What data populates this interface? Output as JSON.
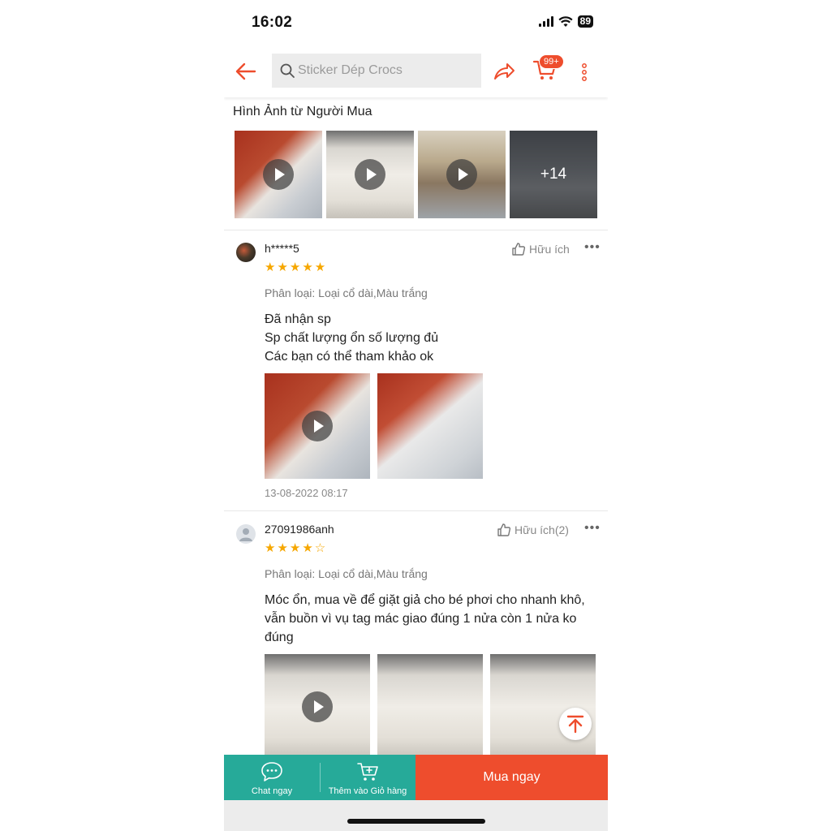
{
  "status_bar": {
    "time": "16:02",
    "battery": "89"
  },
  "header": {
    "search_placeholder": "Sticker Dép Crocs",
    "cart_badge": "99+"
  },
  "buyer_media": {
    "title": "Hình Ảnh từ Người Mua",
    "more_count": "+14"
  },
  "reviews": [
    {
      "username": "h*****5",
      "rating": 5,
      "stars": "★★★★★",
      "helpful": "Hữu ích",
      "variant": "Phân loại: Loại cổ dài,Màu trắng",
      "lines": [
        "Đã nhận sp",
        "Sp chất lượng ổn số lượng đủ",
        "Các bạn có thể tham khảo ok"
      ],
      "date": "13-08-2022 08:17"
    },
    {
      "username": "27091986anh",
      "rating": 4,
      "stars": "★★★★☆",
      "helpful": "Hữu ích(2)",
      "variant": "Phân loại: Loại cổ dài,Màu trắng",
      "lines": [
        "Móc ổn, mua về để giặt giả cho bé phơi cho nhanh khô,",
        "vẫn buồn vì vụ tag mác giao đúng 1 nửa còn 1 nửa ko",
        "đúng"
      ]
    }
  ],
  "bottom_bar": {
    "chat_label": "Chat ngay",
    "add_cart_label": "Thêm vào Giỏ hàng",
    "buy_label": "Mua ngay"
  },
  "colors": {
    "brand": "#ee4d2d",
    "green": "#26aa99",
    "star": "#f6a700"
  }
}
